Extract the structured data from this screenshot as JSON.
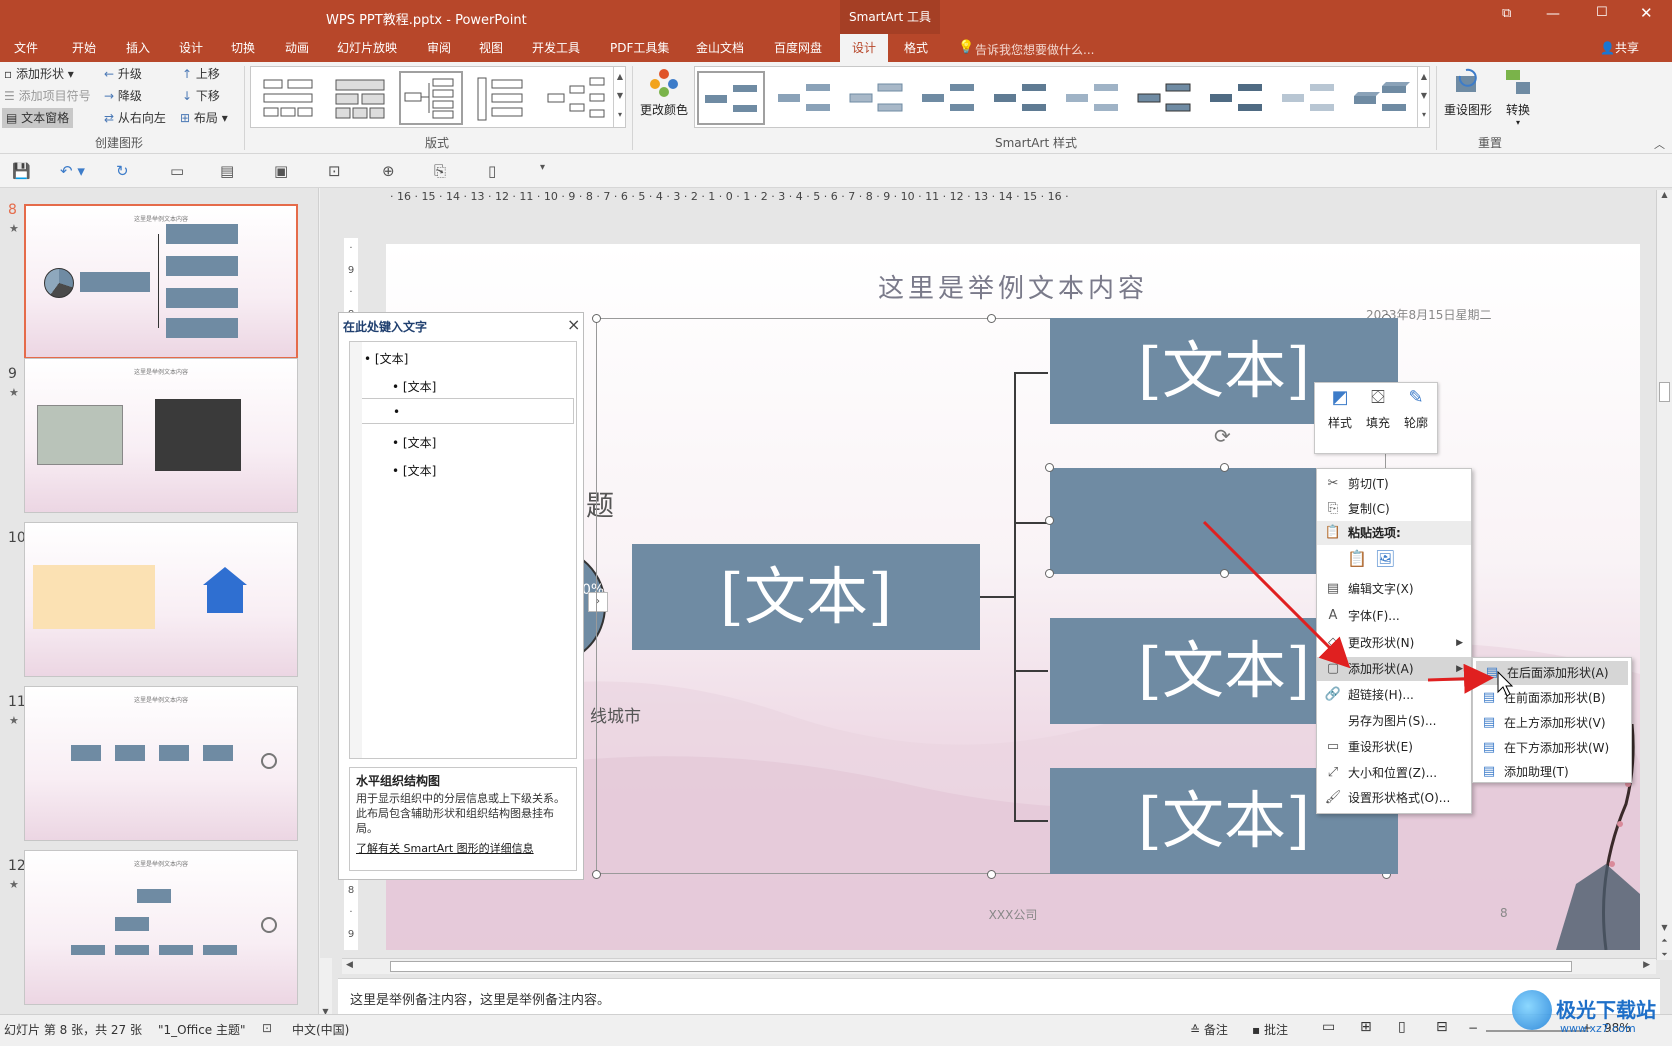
{
  "window": {
    "title": "WPS PPT教程.pptx - PowerPoint",
    "context_tool": "SmartArt 工具",
    "share": "共享",
    "tell_me": "告诉我您想要做什么..."
  },
  "tabs": [
    "文件",
    "开始",
    "插入",
    "设计",
    "切换",
    "动画",
    "幻灯片放映",
    "审阅",
    "视图",
    "开发工具",
    "PDF工具集",
    "金山文档",
    "百度网盘",
    "设计",
    "格式"
  ],
  "active_tab_index": 13,
  "ribbon": {
    "create_graphic": {
      "label": "创建图形",
      "add_shape": "添加形状",
      "add_bullet": "添加项目符号",
      "text_pane": "文本窗格",
      "promote": "升级",
      "demote": "降级",
      "right_to_left": "从右向左",
      "move_up": "上移",
      "move_down": "下移",
      "layout": "布局"
    },
    "layouts_label": "版式",
    "change_colors": "更改颜色",
    "styles_label": "SmartArt 样式",
    "reset": {
      "label": "重置",
      "reset_graphic": "重设图形",
      "convert": "转换"
    }
  },
  "slides_panel": [
    {
      "num": "8",
      "star": true,
      "title": "这里是举例文本内容",
      "selected": true
    },
    {
      "num": "9",
      "star": true,
      "title": "这里是举例文本内容",
      "selected": false
    },
    {
      "num": "10",
      "star": false,
      "title": "",
      "selected": false
    },
    {
      "num": "11",
      "star": true,
      "title": "这里是举例文本内容",
      "selected": false
    },
    {
      "num": "12",
      "star": true,
      "title": "这里是举例文本内容",
      "selected": false
    }
  ],
  "ruler_text": "· 16 · 15 · 14 · 13 · 12 · 11 · 10 · 9 · 8 · 7 · 6 · 5 · 4 · 3 · 2 · 1 · 0 · 1 · 2 · 3 · 4 · 5 · 6 · 7 · 8 · 9 · 10 · 11 · 12 · 13 · 14 · 15 · 16 ·",
  "slide": {
    "title": "这里是举例文本内容",
    "date": "2023年8月15日星期二",
    "footer": "XXX公司",
    "page": "8",
    "partial_title": "题",
    "partial_percent": "0%",
    "partial_city": "线城市",
    "main_box": "[文本]",
    "child_boxes": [
      "[文本]",
      "",
      "[文本]",
      "[文本]"
    ]
  },
  "text_pane": {
    "title": "在此处键入文字",
    "close": "×",
    "lines": [
      "[文本]",
      "[文本]",
      "",
      "[文本]",
      "[文本]"
    ],
    "desc_title": "水平组织结构图",
    "desc": "用于显示组织中的分层信息或上下级关系。此布局包含辅助形状和组织结构图悬挂布局。",
    "link": "了解有关 SmartArt 图形的详细信息"
  },
  "mini_toolbar": {
    "style": "样式",
    "fill": "填充",
    "outline": "轮廓"
  },
  "context_menu": {
    "cut": "剪切(T)",
    "copy": "复制(C)",
    "paste_options": "粘贴选项:",
    "edit_text": "编辑文字(X)",
    "font": "字体(F)...",
    "change_shape": "更改形状(N)",
    "add_shape": "添加形状(A)",
    "hyperlink": "超链接(H)...",
    "save_as_picture": "另存为图片(S)...",
    "reset_shape": "重设形状(E)",
    "size_position": "大小和位置(Z)...",
    "format_shape": "设置形状格式(O)..."
  },
  "submenu": {
    "add_after": "在后面添加形状(A)",
    "add_before": "在前面添加形状(B)",
    "add_above": "在上方添加形状(V)",
    "add_below": "在下方添加形状(W)",
    "add_assistant": "添加助理(T)"
  },
  "notes": "这里是举例备注内容，这里是举例备注内容。",
  "status": {
    "slide_info": "幻灯片 第 8 张，共 27 张",
    "theme": "\"1_Office 主题\"",
    "language": "中文(中国)",
    "notes_btn": "备注",
    "comments_btn": "批注",
    "zoom": "98%"
  },
  "watermark": {
    "text": "极光下载站",
    "url": "www.xz7.com"
  },
  "colors": {
    "accent": "#b7472a",
    "smartart_box": "#6f8ba3",
    "arrow": "#e02020"
  }
}
